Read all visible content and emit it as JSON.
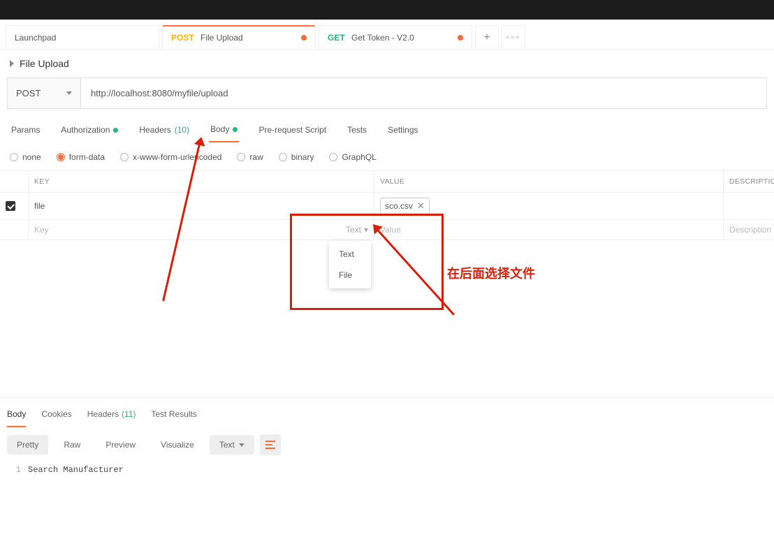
{
  "tabs": {
    "launchpad": "Launchpad",
    "tab1": {
      "method": "POST",
      "name": "File Upload"
    },
    "tab2": {
      "method": "GET",
      "name": "Get Token - V2.0"
    },
    "plus": "+",
    "more": "○○○"
  },
  "title": "File Upload",
  "request": {
    "method": "POST",
    "url": "http://localhost:8080/myfile/upload"
  },
  "req_tabs": {
    "params": "Params",
    "auth": "Authorization",
    "headers": "Headers",
    "headers_count": "(10)",
    "body": "Body",
    "prereq": "Pre-request Script",
    "tests": "Tests",
    "settings": "Settings"
  },
  "body_types": {
    "none": "none",
    "form": "form-data",
    "xwww": "x-www-form-urlencoded",
    "raw": "raw",
    "binary": "binary",
    "gql": "GraphQL"
  },
  "kv": {
    "head": {
      "key": "KEY",
      "value": "VALUE",
      "desc": "DESCRIPTION"
    },
    "row1": {
      "key": "file",
      "value": "sco.csv"
    },
    "row2": {
      "key_placeholder": "Key",
      "type_label": "Text",
      "value_placeholder": "Value",
      "desc_placeholder": "Description"
    },
    "dropdown": {
      "opt1": "Text",
      "opt2": "File"
    }
  },
  "response": {
    "tabs": {
      "body": "Body",
      "cookies": "Cookies",
      "headers": "Headers",
      "headers_count": "(11)",
      "tests": "Test Results"
    },
    "view": {
      "pretty": "Pretty",
      "raw": "Raw",
      "preview": "Preview",
      "visualize": "Visualize",
      "format": "Text"
    },
    "line_no": "1",
    "body_text": "Search Manufacturer"
  },
  "annotation": "在后面选择文件"
}
